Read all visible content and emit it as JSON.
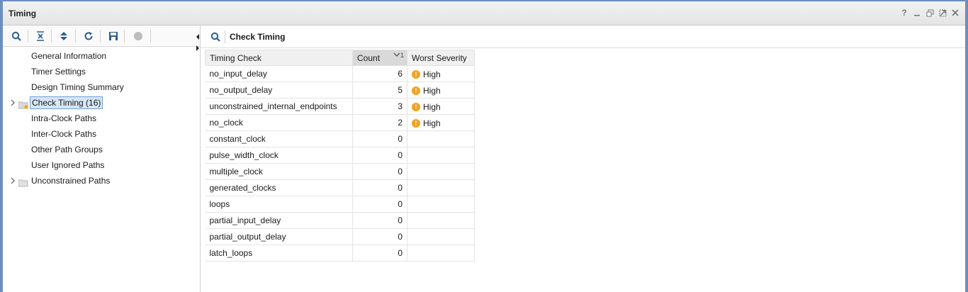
{
  "window": {
    "title": "Timing",
    "controls": [
      "?",
      "minimize-icon",
      "restore-icon",
      "maximize-icon",
      "close-icon"
    ],
    "help_label": "?"
  },
  "left_toolbar": {
    "icons": [
      "search-icon",
      "collapse-all-icon",
      "expand-all-icon",
      "refresh-icon",
      "save-icon",
      "stop-icon"
    ]
  },
  "tree": {
    "items": [
      {
        "label": "General Information",
        "expandable": false,
        "folder": false
      },
      {
        "label": "Timer Settings",
        "expandable": false,
        "folder": false
      },
      {
        "label": "Design Timing Summary",
        "expandable": false,
        "folder": false
      },
      {
        "label": "Check Timing (16)",
        "expandable": true,
        "folder": true,
        "selected": true
      },
      {
        "label": "Intra-Clock Paths",
        "expandable": false,
        "folder": false
      },
      {
        "label": "Inter-Clock Paths",
        "expandable": false,
        "folder": false
      },
      {
        "label": "Other Path Groups",
        "expandable": false,
        "folder": false
      },
      {
        "label": "User Ignored Paths",
        "expandable": false,
        "folder": false
      },
      {
        "label": "Unconstrained Paths",
        "expandable": true,
        "folder": true
      }
    ]
  },
  "panel": {
    "title": "Check Timing",
    "columns": {
      "check": "Timing Check",
      "count": "Count",
      "severity": "Worst Severity",
      "sort_rank": "1"
    },
    "rows": [
      {
        "check": "no_input_delay",
        "count": "6",
        "severity": "High"
      },
      {
        "check": "no_output_delay",
        "count": "5",
        "severity": "High"
      },
      {
        "check": "unconstrained_internal_endpoints",
        "count": "3",
        "severity": "High"
      },
      {
        "check": "no_clock",
        "count": "2",
        "severity": "High"
      },
      {
        "check": "constant_clock",
        "count": "0",
        "severity": ""
      },
      {
        "check": "pulse_width_clock",
        "count": "0",
        "severity": ""
      },
      {
        "check": "multiple_clock",
        "count": "0",
        "severity": ""
      },
      {
        "check": "generated_clocks",
        "count": "0",
        "severity": ""
      },
      {
        "check": "loops",
        "count": "0",
        "severity": ""
      },
      {
        "check": "partial_input_delay",
        "count": "0",
        "severity": ""
      },
      {
        "check": "partial_output_delay",
        "count": "0",
        "severity": ""
      },
      {
        "check": "latch_loops",
        "count": "0",
        "severity": ""
      }
    ]
  },
  "colors": {
    "window_border": "#6c8ebf",
    "selection_bg": "#d5e6f7",
    "warning": "#f5a21b"
  }
}
